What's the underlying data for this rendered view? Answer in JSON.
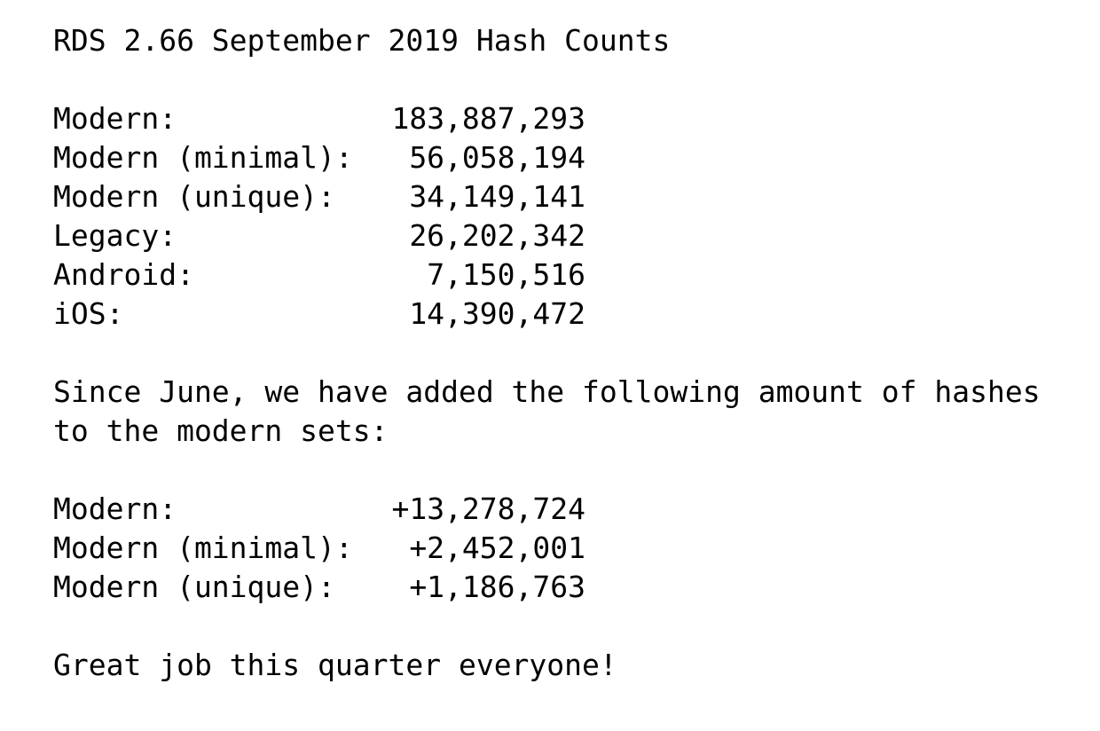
{
  "title": "RDS 2.66 September 2019 Hash Counts",
  "counts": [
    {
      "label": "Modern:",
      "value": "183,887,293"
    },
    {
      "label": "Modern (minimal):",
      "value": "56,058,194"
    },
    {
      "label": "Modern (unique):",
      "value": "34,149,141"
    },
    {
      "label": "Legacy:",
      "value": "26,202,342"
    },
    {
      "label": "Android:",
      "value": "7,150,516"
    },
    {
      "label": "iOS:",
      "value": "14,390,472"
    }
  ],
  "paragraph": "Since June, we have added the following amount of hashes to the modern sets:",
  "additions": [
    {
      "label": "Modern:",
      "value": "+13,278,724"
    },
    {
      "label": "Modern (minimal):",
      "value": "+2,452,001"
    },
    {
      "label": "Modern (unique):",
      "value": "+1,186,763"
    }
  ],
  "closing": "Great job this quarter everyone!"
}
